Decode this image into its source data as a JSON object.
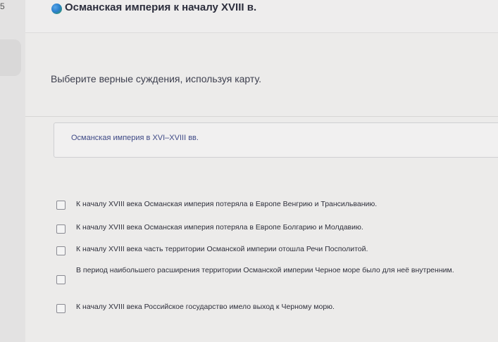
{
  "page": {
    "number": "5"
  },
  "header": {
    "title": "Османская империя к началу XVIII в."
  },
  "question": {
    "instruction": "Выберите верные суждения, используя карту."
  },
  "map_dropdown": {
    "label": "Османская империя в XVI–XVIII вв.",
    "chevron": "⌄"
  },
  "options": [
    {
      "text": "К началу XVIII века Османская империя потеряла в Европе Венгрию и Трансильванию.",
      "checked": false
    },
    {
      "text": "К началу XVIII века Османская империя потеряла в Европе Болгарию и Молдавию.",
      "checked": false
    },
    {
      "text": "К началу XVIII века часть территории Османской империи отошла Речи Посполитой.",
      "checked": false
    },
    {
      "text": "В период наибольшего расширения территории Османской империи Черное море было для неё внутренним.",
      "checked": false
    },
    {
      "text": "К началу XVIII века Российское государство имело выход к Черному морю.",
      "checked": false
    }
  ]
}
